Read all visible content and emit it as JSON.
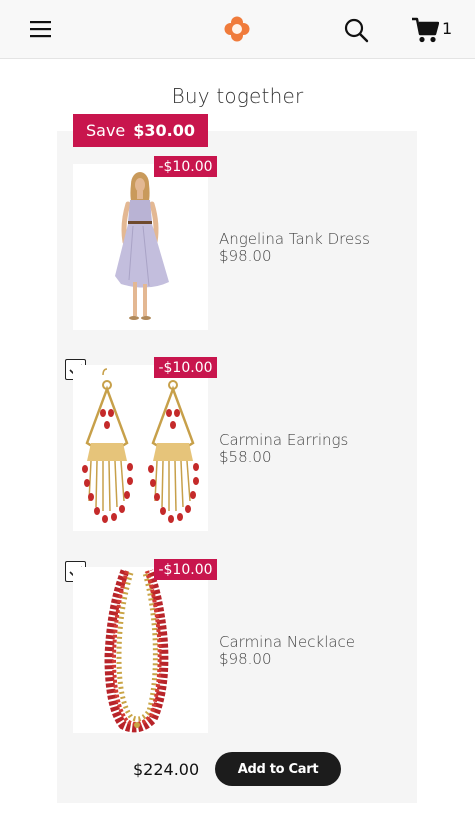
{
  "header": {
    "cart_count": "1"
  },
  "bundle": {
    "title": "Buy together",
    "save_prefix": "Save",
    "save_amount": "$30.00",
    "products": [
      {
        "name": "Angelina Tank Dress",
        "price": "$98.00",
        "discount": "-$10.00",
        "checked": null
      },
      {
        "name": "Carmina Earrings",
        "price": "$58.00",
        "discount": "-$10.00",
        "checked": true
      },
      {
        "name": "Carmina Necklace",
        "price": "$98.00",
        "discount": "-$10.00",
        "checked": true
      }
    ],
    "total": "$224.00",
    "add_to_cart_label": "Add to Cart"
  },
  "colors": {
    "accent": "#c8154d",
    "logo": "#f07b3b",
    "button": "#1c1c1c",
    "panel": "#f5f5f5"
  },
  "icons": [
    "hamburger-menu-icon",
    "logo-icon",
    "search-icon",
    "cart-icon",
    "checkmark-icon"
  ]
}
